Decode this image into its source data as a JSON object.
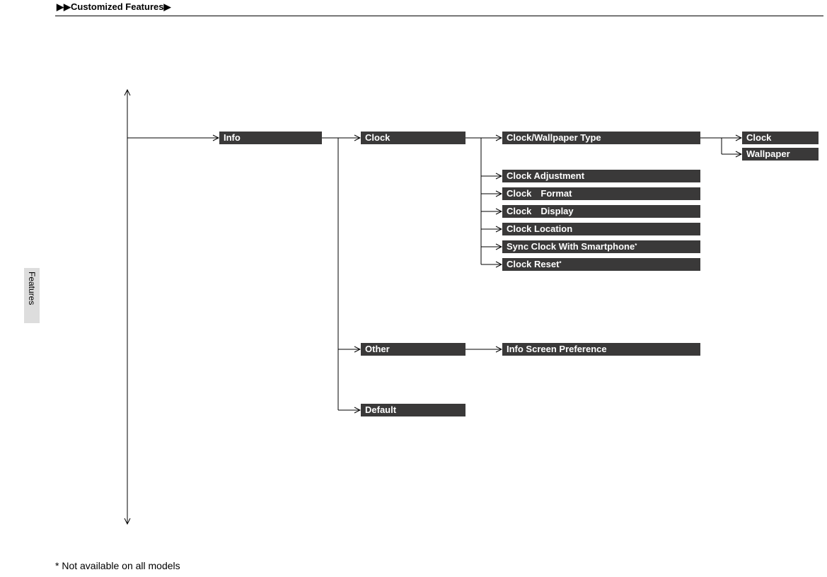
{
  "header": {
    "prefix": "▶▶",
    "title": "Customized Features",
    "suffix": "▶"
  },
  "side_tab": "Features",
  "nodes": {
    "info": "Info",
    "clock": "Clock",
    "other": "Other",
    "default": "Default",
    "clock_wallpaper_type": "Clock/Wallpaper Type",
    "clock_adjustment": "Clock Adjustment",
    "clock_format": "Clock Format",
    "clock_display": "Clock Display",
    "clock_location": "Clock Location",
    "sync_clock": "Sync Clock With Smartphone",
    "clock_reset": "Clock Reset",
    "info_screen_pref": "Info Screen Preference",
    "clock2": "Clock",
    "wallpaper": "Wallpaper"
  },
  "asterisk": "*",
  "footnote": "*   Not available on all models"
}
